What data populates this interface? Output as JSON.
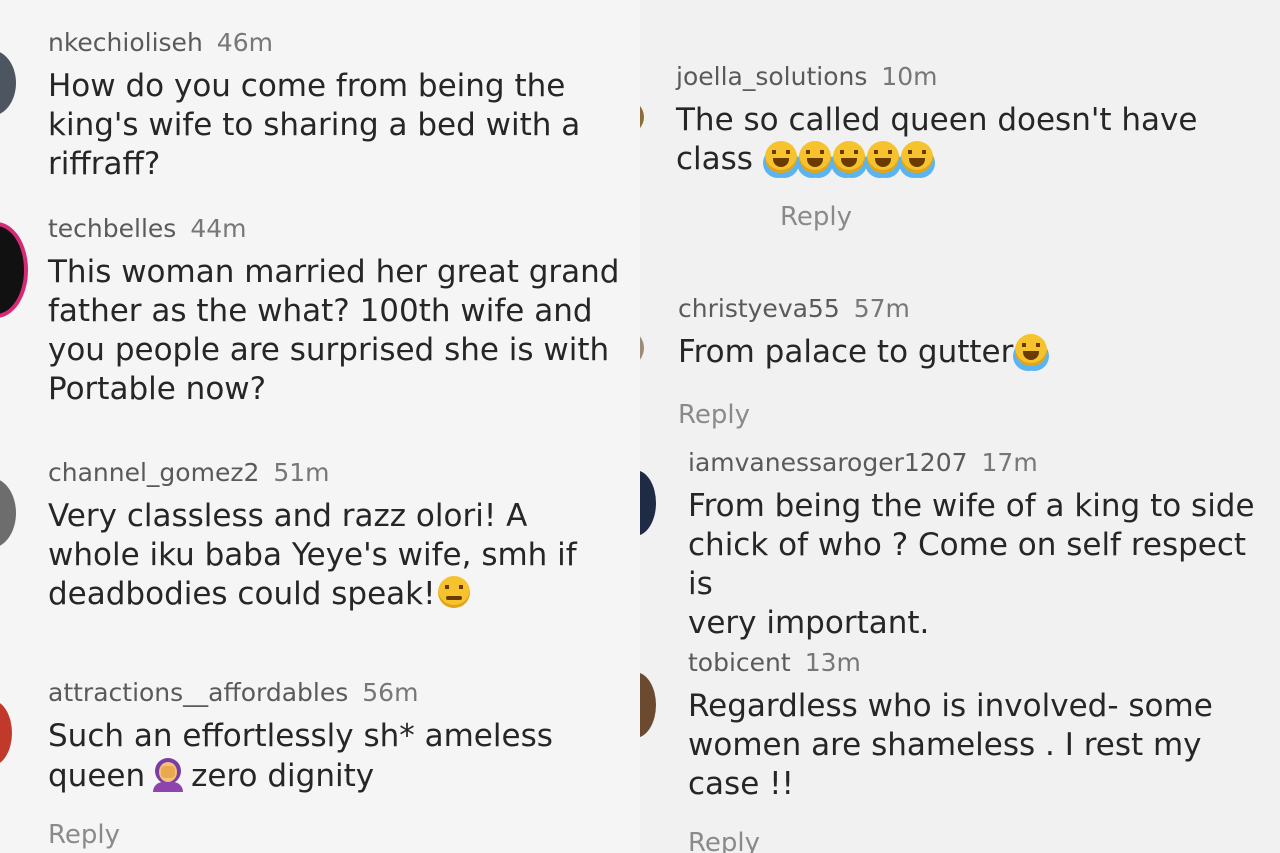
{
  "left": {
    "comments": [
      {
        "user": "nkechioliseh",
        "time": "46m",
        "text": "How do you come from being the\nking's wife to sharing a bed with a\nriffraff?"
      },
      {
        "user": "techbelles",
        "time": "44m",
        "text": "This woman married her great grand\nfather as the what? 100th wife and\nyou people  are surprised she is with\nPortable now?"
      },
      {
        "user": "channel_gomez2",
        "time": "51m",
        "text": "Very classless and razz olori! A\nwhole iku baba Yeye's wife, smh if\ndeadbodies could speak!"
      },
      {
        "user": "attractions__affordables",
        "time": "56m",
        "text_a": "Such an effortlessly sh* ameless\nqueen",
        "text_b": "zero dignity"
      }
    ],
    "reply": "Reply"
  },
  "right": {
    "comments": [
      {
        "user": "joella_solutions",
        "time": "10m",
        "text": "The so called queen doesn't have\nclass",
        "reply": "Reply"
      },
      {
        "user": "christyeva55",
        "time": "57m",
        "text": "From palace to gutter",
        "reply": "Reply"
      },
      {
        "user": "iamvanessaroger1207",
        "time": "17m",
        "text": "From being the wife of a king to side\nchick of who ? Come on self respect is\nvery important."
      },
      {
        "user": "tobicent",
        "time": "13m",
        "text": "Regardless who is involved- some\nwomen are shameless . I rest my\ncase !!",
        "reply": "Reply"
      }
    ]
  },
  "emoji": {
    "joy": "face-with-tears-of-joy-icon",
    "woozy": "woozy-face-icon",
    "facepalm": "woman-facepalming-icon"
  },
  "colors": {
    "text": "#262626",
    "meta": "#5a5a5a",
    "reply": "#8a8a8a",
    "background": "#f3f3f3"
  }
}
